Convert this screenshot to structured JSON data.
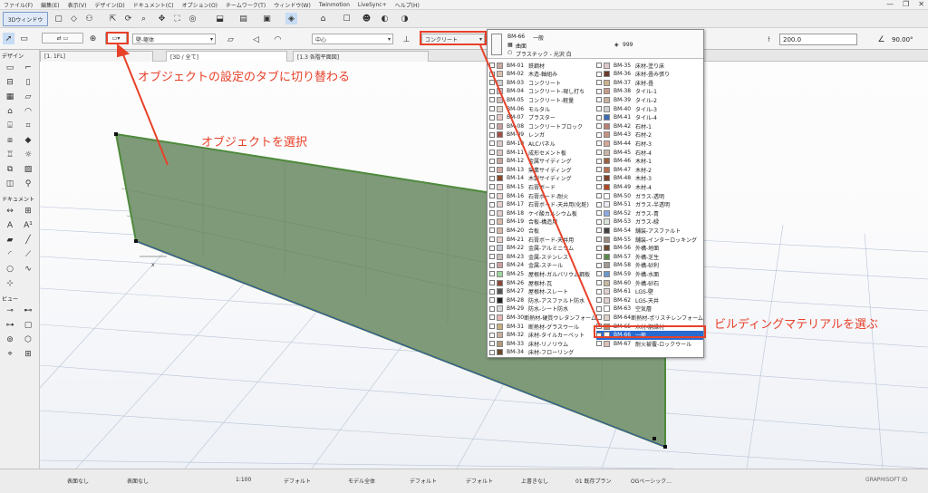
{
  "menubar": {
    "items": [
      "ファイル(F)",
      "編集(E)",
      "表示(V)",
      "デザイン(D)",
      "ドキュメント(C)",
      "オプション(O)",
      "チームワーク(T)",
      "ウィンドウ(W)",
      "Twinmotion",
      "LiveSync+",
      "ヘルプ(H)"
    ],
    "win": [
      "—",
      "❐",
      "✕"
    ]
  },
  "toolbar": {
    "view3d": "3Dウィンドウ",
    "layer": "壁-躯体",
    "center": "中心",
    "material": "コンクリート",
    "height_value": "200.0",
    "angle_value": "90.00°"
  },
  "popup": {
    "header_code": "BM-66",
    "header_name": "一般",
    "header_sub1": "曲面",
    "header_sub2": "プラスチック - 光沢 白",
    "header_priority": "999",
    "left": [
      {
        "c": "BM-01",
        "n": "鉄鋼材",
        "col": "#c9a9a0"
      },
      {
        "c": "BM-02",
        "n": "木造-軸組み",
        "col": "#d7c2b0"
      },
      {
        "c": "BM-03",
        "n": "コンクリート",
        "col": "#cfcfcf"
      },
      {
        "c": "BM-04",
        "n": "コンクリート-現し打ち",
        "col": "#d8b8b8"
      },
      {
        "c": "BM-05",
        "n": "コンクリート-軽量",
        "col": "#d4c0c0"
      },
      {
        "c": "BM-06",
        "n": "モルタル",
        "col": "#e0d7d0"
      },
      {
        "c": "BM-07",
        "n": "プラスター",
        "col": "#e8c7c7"
      },
      {
        "c": "BM-08",
        "n": "コンクリートブロック",
        "col": "#c4a0a0"
      },
      {
        "c": "BM-09",
        "n": "レンガ",
        "col": "#a05048"
      },
      {
        "c": "BM-10",
        "n": "ALCパネル",
        "col": "#d9c9c9"
      },
      {
        "c": "BM-11",
        "n": "成形セメント板",
        "col": "#d8c6c6"
      },
      {
        "c": "BM-12",
        "n": "金属サイディング",
        "col": "#c8a6a0"
      },
      {
        "c": "BM-13",
        "n": "窯業サイディング",
        "col": "#d2aaa0"
      },
      {
        "c": "BM-14",
        "n": "木製サイディング",
        "col": "#8a4a2a"
      },
      {
        "c": "BM-15",
        "n": "石膏ボード",
        "col": "#e6d0d0"
      },
      {
        "c": "BM-16",
        "n": "石膏ボード-耐火",
        "col": "#e6d0d0"
      },
      {
        "c": "BM-17",
        "n": "石膏ボード-天井用(化粧)",
        "col": "#e6d0d0"
      },
      {
        "c": "BM-18",
        "n": "ケイ酸カルシウム板",
        "col": "#e0cccc"
      },
      {
        "c": "BM-19",
        "n": "合板-構造用",
        "col": "#d7b9a8"
      },
      {
        "c": "BM-20",
        "n": "合板",
        "col": "#d7b9a8"
      },
      {
        "c": "BM-21",
        "n": "石膏ボード-天井用",
        "col": "#e6d0d0"
      },
      {
        "c": "BM-22",
        "n": "金属-アルミニウム",
        "col": "#c9c9d4"
      },
      {
        "c": "BM-23",
        "n": "金属-ステンレス",
        "col": "#c9c0c0"
      },
      {
        "c": "BM-24",
        "n": "金属-スチール",
        "col": "#c9a0a0"
      },
      {
        "c": "BM-25",
        "n": "屋根材-ガルバリウム鋼板",
        "col": "#9ed49e"
      },
      {
        "c": "BM-26",
        "n": "屋根材-瓦",
        "col": "#8a4a3a"
      },
      {
        "c": "BM-27",
        "n": "屋根材-スレート",
        "col": "#555555"
      },
      {
        "c": "BM-28",
        "n": "防水-アスファルト防水",
        "col": "#222222"
      },
      {
        "c": "BM-29",
        "n": "防水-シート防水",
        "col": "#d9d9d9"
      },
      {
        "c": "BM-30",
        "n": "断熱材-硬質ウレタンフォーム",
        "col": "#e6b7b7"
      },
      {
        "c": "BM-31",
        "n": "断熱材-グラスウール",
        "col": "#c8b080"
      },
      {
        "c": "BM-32",
        "n": "床材-タイルカーペット",
        "col": "#c8b0a0"
      },
      {
        "c": "BM-33",
        "n": "床材-リノリウム",
        "col": "#b09a7a"
      },
      {
        "c": "BM-34",
        "n": "床材-フローリング",
        "col": "#6a4a2a"
      }
    ],
    "right": [
      {
        "c": "BM-35",
        "n": "床材-塗り床",
        "col": "#e0c8c8"
      },
      {
        "c": "BM-36",
        "n": "床材-畳み張り",
        "col": "#6a3a2a"
      },
      {
        "c": "BM-37",
        "n": "床材-畳",
        "col": "#cbb28a"
      },
      {
        "c": "BM-38",
        "n": "タイル-1",
        "col": "#c89a8a"
      },
      {
        "c": "BM-39",
        "n": "タイル-2",
        "col": "#c9b0a0"
      },
      {
        "c": "BM-40",
        "n": "タイル-3",
        "col": "#d0d0d0"
      },
      {
        "c": "BM-41",
        "n": "タイル-4",
        "col": "#3a6ab0"
      },
      {
        "c": "BM-42",
        "n": "石材-1",
        "col": "#b88070"
      },
      {
        "c": "BM-43",
        "n": "石材-2",
        "col": "#c49080"
      },
      {
        "c": "BM-44",
        "n": "石材-3",
        "col": "#d4a898"
      },
      {
        "c": "BM-45",
        "n": "石材-4",
        "col": "#c8b4a8"
      },
      {
        "c": "BM-46",
        "n": "木材-1",
        "col": "#9a6040"
      },
      {
        "c": "BM-47",
        "n": "木材-2",
        "col": "#b47050"
      },
      {
        "c": "BM-48",
        "n": "木材-3",
        "col": "#7a4228"
      },
      {
        "c": "BM-49",
        "n": "木材-4",
        "col": "#b04a20"
      },
      {
        "c": "BM-50",
        "n": "ガラス-透明",
        "col": "#ffffff"
      },
      {
        "c": "BM-51",
        "n": "ガラス-半透明",
        "col": "#eaeaf4"
      },
      {
        "c": "BM-52",
        "n": "ガラス-青",
        "col": "#8aa8e0"
      },
      {
        "c": "BM-53",
        "n": "ガラス-緑",
        "col": "#d9e6d9"
      },
      {
        "c": "BM-54",
        "n": "舗装-アスファルト",
        "col": "#444444"
      },
      {
        "c": "BM-55",
        "n": "舗装-インターロッキング",
        "col": "#9a8a80"
      },
      {
        "c": "BM-56",
        "n": "外構-地面",
        "col": "#6a4a30"
      },
      {
        "c": "BM-57",
        "n": "外構-芝生",
        "col": "#5a8a4a"
      },
      {
        "c": "BM-58",
        "n": "外構-砂利",
        "col": "#a09a90"
      },
      {
        "c": "BM-59",
        "n": "外構-水面",
        "col": "#6a9ac8"
      },
      {
        "c": "BM-60",
        "n": "外構-砂石",
        "col": "#c8b8a0"
      },
      {
        "c": "BM-61",
        "n": "LGS-壁",
        "col": "#e0d0d0"
      },
      {
        "c": "BM-62",
        "n": "LGS-天井",
        "col": "#e0d0d0"
      },
      {
        "c": "BM-63",
        "n": "空気層",
        "col": "#ffffff"
      },
      {
        "c": "BM-64",
        "n": "断熱材-ポリスチレンフォーム",
        "col": "#e0d0c8"
      },
      {
        "c": "BM-65",
        "n": "木材-胴縁材",
        "col": "#c09070"
      },
      {
        "c": "BM-66",
        "n": "一般",
        "col": "#ffffff"
      },
      {
        "c": "BM-67",
        "n": "耐火被覆-ロックウール",
        "col": "#d8c0b8"
      }
    ]
  },
  "tabs": [
    "[1. 1FL]",
    "[3D / 全て]",
    "[1.3 各階平面図]"
  ],
  "annotations": {
    "tab": "オブジェクトの設定のタブに切り替わる",
    "select": "オブジェクトを選択",
    "material": "ビルディングマテリアルを選ぶ"
  },
  "palette": {
    "design": "デザイン",
    "document": "ドキュメント",
    "view": "ビュー"
  },
  "status": {
    "none1": "表面なし",
    "none2": "表面なし",
    "scale": "1:100",
    "default1": "デフォルト",
    "model": "モデル全体",
    "default2": "デフォルト",
    "default3": "デフォルト",
    "no_overwrite": "上書きなし",
    "plan": "01 既存プラン",
    "og": "OGベーシック...",
    "brand": "GRAPHISOFT ID"
  },
  "colors": {
    "accent": "#e8412a",
    "selection": "#2a6bd1",
    "wall": "#7e9a78"
  }
}
